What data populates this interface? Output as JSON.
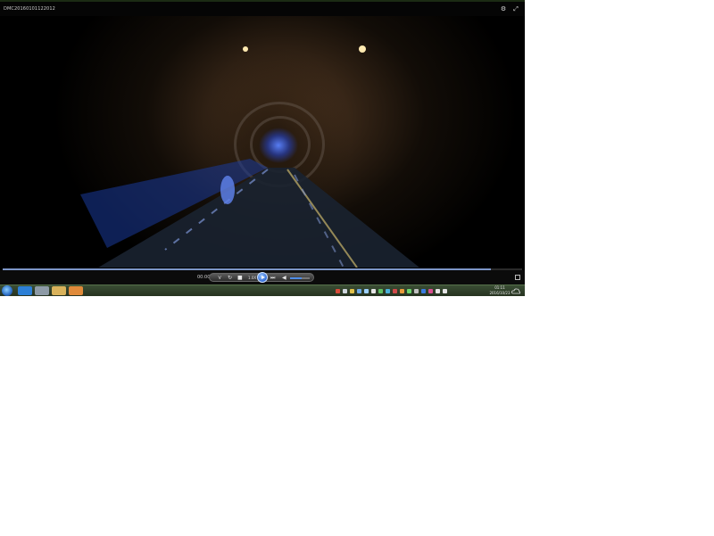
{
  "window": {
    "title": "DMC20160101122012",
    "settings_icon": "gear-icon",
    "fullscreen_icon": "fullscreen-icon"
  },
  "player": {
    "current_time": "00:00",
    "seek_progress": 0.94,
    "speed_label": "1.0X",
    "volume_level": 0.6,
    "controls": {
      "prev_icon": "previous-icon",
      "repeat_icon": "repeat-icon",
      "stop_icon": "stop-icon",
      "play_icon": "play-icon",
      "next_icon": "next-icon",
      "volume_icon": "speaker-icon"
    }
  },
  "taskbar": {
    "start_icon": "windows-start-icon",
    "apps": [
      {
        "name": "internet-explorer-icon",
        "color": "#2c7fd6"
      },
      {
        "name": "media-player-icon",
        "color": "#8d9aa6"
      },
      {
        "name": "folder-icon",
        "color": "#d9b25b"
      },
      {
        "name": "video-app-icon",
        "color": "#e08a3a"
      }
    ],
    "clock_time": "01:11",
    "clock_date": "2016/10/23"
  },
  "colors": {
    "accent_blue": "#4f8de8",
    "taskbar_green": "#2f3f29"
  }
}
